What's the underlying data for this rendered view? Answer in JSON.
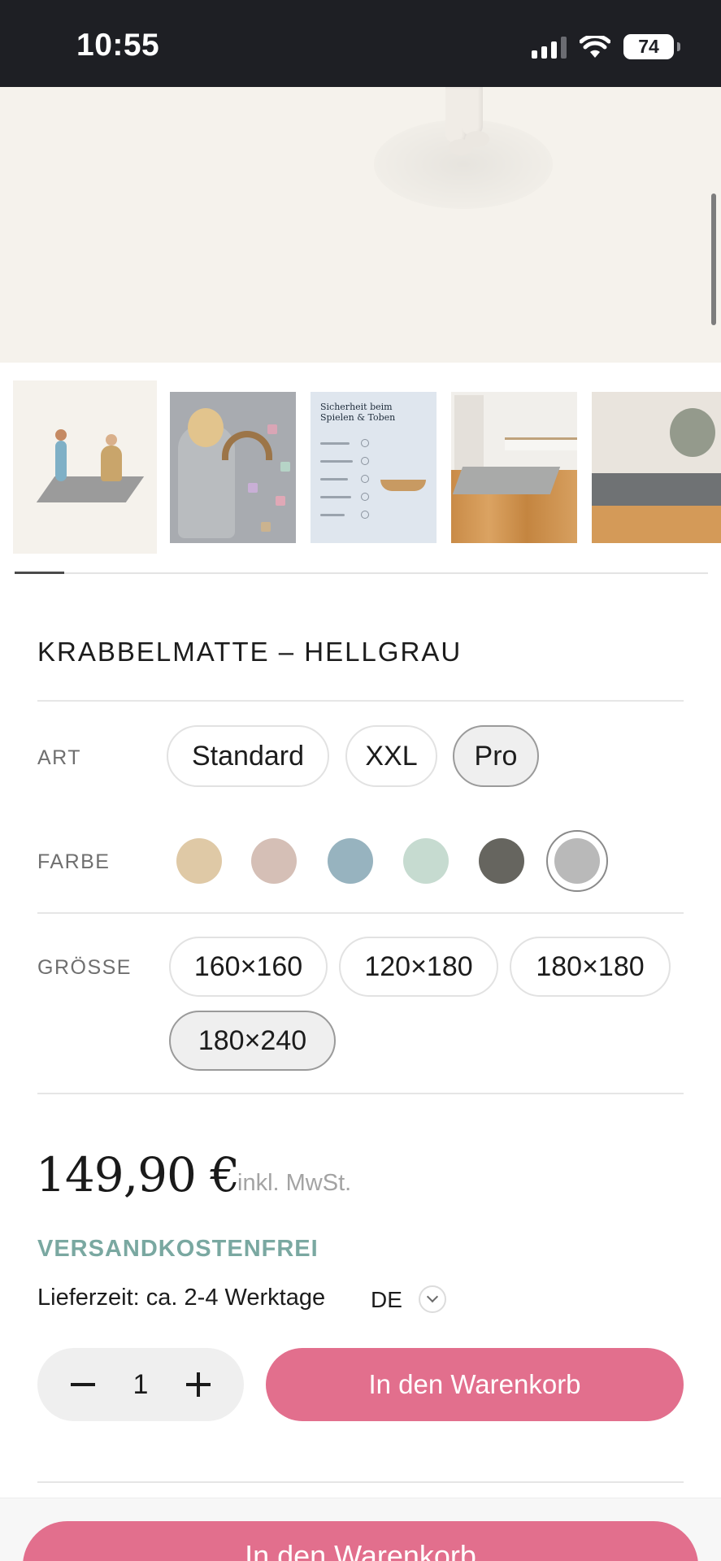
{
  "status_bar": {
    "time": "10:55",
    "battery": "74"
  },
  "gallery": {
    "thumbnail_3_title": "Sicherheit beim Spielen & Toben"
  },
  "product": {
    "title": "KRABBELMATTE – HELLGRAU"
  },
  "options": {
    "type": {
      "label": "ART",
      "choices": [
        "Standard",
        "XXL",
        "Pro"
      ],
      "selected": "Pro"
    },
    "color": {
      "label": "FARBE",
      "swatches": [
        "#dfc9a6",
        "#d5bfb6",
        "#97b3bf",
        "#c6dbd0",
        "#66655f",
        "#b9b9b9"
      ],
      "selected_index": 5
    },
    "size": {
      "label": "GRÖSSE",
      "choices": [
        "160×160",
        "120×180",
        "180×180",
        "180×240"
      ],
      "selected": "180×240"
    }
  },
  "pricing": {
    "price": "149,90 €",
    "tax_note": "inkl. MwSt.",
    "shipping": "VERSANDKOSTENFREI",
    "delivery": "Lieferzeit: ca. 2-4 Werktage",
    "country": "DE"
  },
  "cart": {
    "quantity": "1",
    "add_label": "In den Warenkorb",
    "sticky_label": "In den Warenkorb"
  },
  "colors": {
    "accent": "#e26f8d",
    "shipping_text": "#7aa8a1"
  }
}
